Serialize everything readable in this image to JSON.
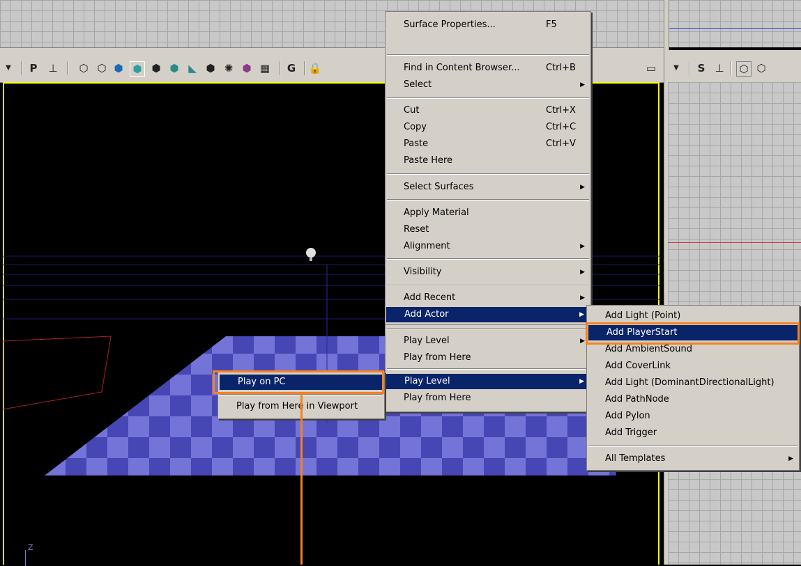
{
  "toolbar": {
    "perspective_letter": "P",
    "grid_letter": "G",
    "side_letter": "S"
  },
  "viewport": {
    "axis_label": "Z"
  },
  "context_menu": {
    "items": [
      {
        "label": "Surface Properties...",
        "shortcut": "F5"
      },
      {
        "label": "Find in Content Browser...",
        "shortcut": "Ctrl+B"
      },
      {
        "label": "Select",
        "shortcut": ""
      },
      {
        "label": "Cut",
        "shortcut": "Ctrl+X"
      },
      {
        "label": "Copy",
        "shortcut": "Ctrl+C"
      },
      {
        "label": "Paste",
        "shortcut": "Ctrl+V"
      },
      {
        "label": "Paste Here",
        "shortcut": ""
      },
      {
        "label": "Select Surfaces",
        "shortcut": ""
      },
      {
        "label": "Apply Material",
        "shortcut": ""
      },
      {
        "label": "Reset",
        "shortcut": ""
      },
      {
        "label": "Alignment",
        "shortcut": ""
      },
      {
        "label": "Visibility",
        "shortcut": ""
      },
      {
        "label": "Add Recent",
        "shortcut": ""
      },
      {
        "label": "Add Actor",
        "shortcut": ""
      },
      {
        "label": "Play Level",
        "shortcut": ""
      },
      {
        "label": "Play from Here",
        "shortcut": ""
      }
    ]
  },
  "play_menu": {
    "items": [
      {
        "label": "Play Level"
      },
      {
        "label": "Play from Here"
      }
    ]
  },
  "play_submenu": {
    "items": [
      {
        "label": "Play on PC"
      },
      {
        "label": "Play from Here in Viewport"
      }
    ]
  },
  "actor_submenu": {
    "items": [
      {
        "label": "Add Light (Point)"
      },
      {
        "label": "Add PlayerStart"
      },
      {
        "label": "Add AmbientSound"
      },
      {
        "label": "Add CoverLink"
      },
      {
        "label": "Add Light (DominantDirectionalLight)"
      },
      {
        "label": "Add PathNode"
      },
      {
        "label": "Add Pylon"
      },
      {
        "label": "Add Trigger"
      },
      {
        "label": "All Templates"
      }
    ]
  },
  "colors": {
    "highlight": "#0a246a",
    "callout": "#f58220",
    "viewport_border": "#ffff00",
    "floor": "#5a5ac8"
  }
}
